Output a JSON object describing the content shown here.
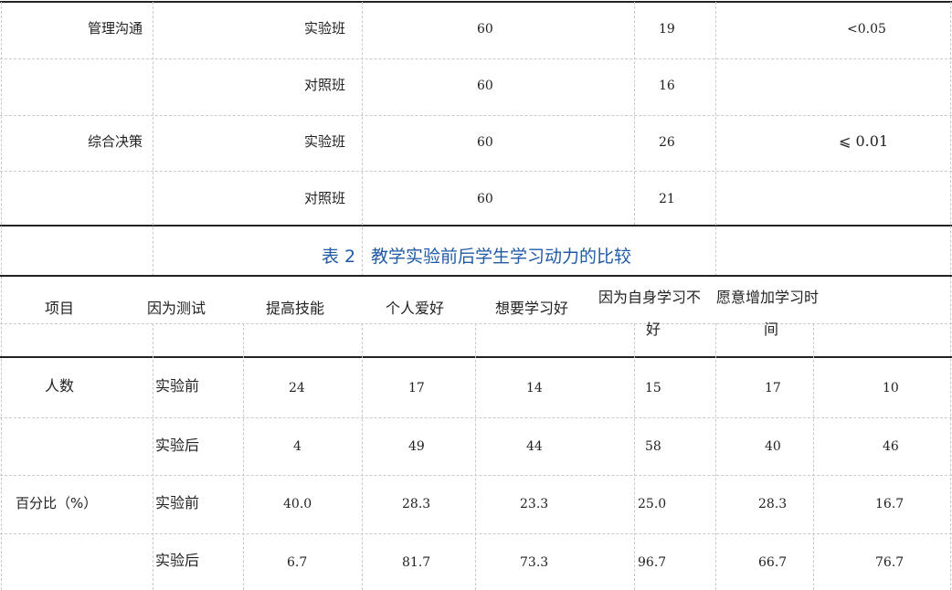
{
  "table1": {
    "rows": [
      {
        "item": "管理沟通",
        "group": "实验班",
        "n": "60",
        "score": "19",
        "p": "<0.05"
      },
      {
        "item": "",
        "group": "对照班",
        "n": "60",
        "score": "16",
        "p": ""
      },
      {
        "item": "综合决策",
        "group": "实验班",
        "n": "60",
        "score": "26",
        "p": "⩽ 0.01"
      },
      {
        "item": "",
        "group": "对照班",
        "n": "60",
        "score": "21",
        "p": ""
      }
    ]
  },
  "table2": {
    "title_num": "表 2",
    "title_text": "教学实验前后学生学习动力的比较",
    "headers": {
      "h1": "项目",
      "h2": "因为测试",
      "h3": "提高技能",
      "h4": "个人爱好",
      "h5": "想要学习好",
      "h6a": "因为自身学习不",
      "h6b": "好",
      "h7a": "愿意增加学习时",
      "h7b": "间"
    },
    "rows": [
      {
        "label": "人数",
        "phase": "实验前",
        "values": [
          "24",
          "17",
          "14",
          "15",
          "17",
          "10"
        ]
      },
      {
        "label": "",
        "phase": "实验后",
        "values": [
          "4",
          "49",
          "44",
          "58",
          "40",
          "46"
        ]
      },
      {
        "label": "百分比（%）",
        "phase": "实验前",
        "values": [
          "40.0",
          "28.3",
          "23.3",
          "25.0",
          "28.3",
          "16.7"
        ]
      },
      {
        "label": "",
        "phase": "实验后",
        "values": [
          "6.7",
          "81.7",
          "73.3",
          "96.7",
          "66.7",
          "76.7"
        ]
      }
    ]
  }
}
